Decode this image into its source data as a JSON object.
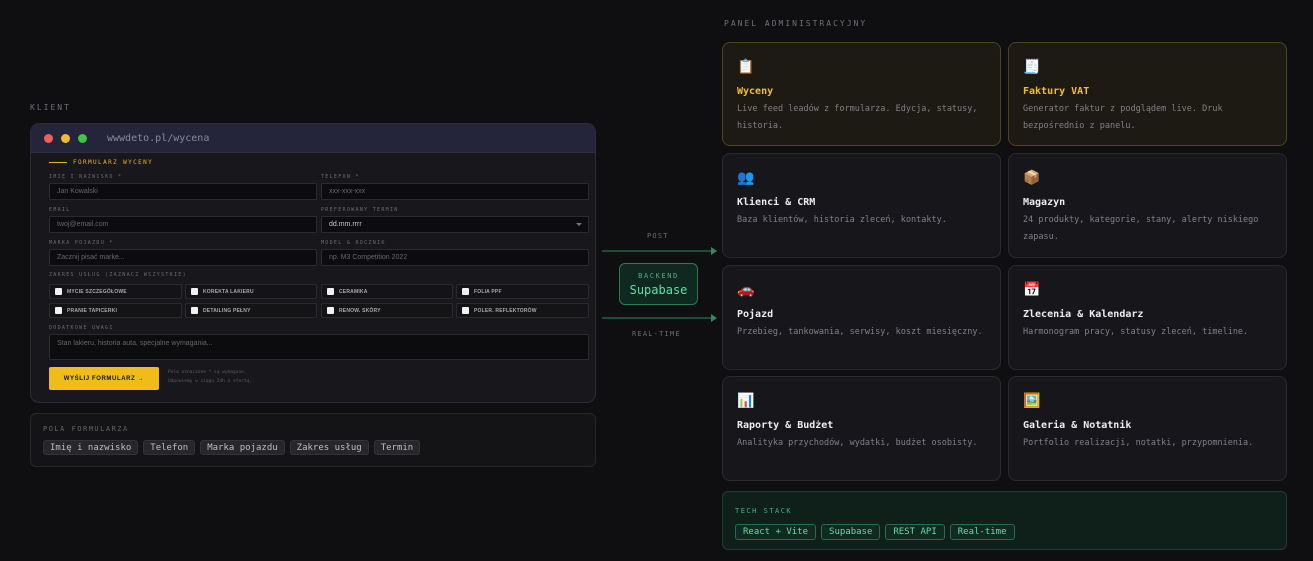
{
  "client": {
    "label": "KLIENT",
    "browser": {
      "url": "wwwdeto.pl/wycena",
      "form_title": "FORMULARZ WYCENY",
      "fields": {
        "name_label": "IMIĘ I NAZWISKO *",
        "name_placeholder": "Jan Kowalski",
        "phone_label": "TELEFON *",
        "phone_placeholder": "xxx-xxx-xxx",
        "email_label": "EMAIL",
        "email_placeholder": "twoj@email.com",
        "date_label": "PREFEROWANY TERMIN",
        "date_value": "dd.mm.rrrr",
        "brand_label": "MARKA POJAZDU *",
        "brand_placeholder": "Zacznij pisać marke...",
        "model_label": "MODEL & ROCZNIK",
        "model_placeholder": "np. M3 Competition 2022",
        "services_label": "ZAKRES USŁUG (ZAZNACZ WSZYSTKIE)",
        "services": [
          "MYCIE SZCZEGÓŁOWE",
          "KOREKTA LAKIERU",
          "CERAMIKA",
          "FOLIA PPF",
          "PRANIE TAPICERKI",
          "DETAILING PEŁNY",
          "RENOW. SKÓRY",
          "POLER. REFLEKTORÓW"
        ],
        "notes_label": "DODATKOWE UWAGI",
        "notes_placeholder": "Stan lakieru, historia auta, specjalne wymagania..."
      },
      "submit_label": "WYŚLIJ FORMULARZ →",
      "note_line1": "Pola oznaczone * są wymagane.",
      "note_line2": "Odpowiemy w ciągu 24h z ofertą."
    },
    "form_fields_box": {
      "label": "POLA FORMULARZA",
      "chips": [
        "Imię i nazwisko",
        "Telefon",
        "Marka pojazdu",
        "Zakres usług",
        "Termin"
      ]
    }
  },
  "flow": {
    "post_label": "POST",
    "realtime_label": "REAL-TIME",
    "backend_label": "BACKEND",
    "backend_name": "Supabase"
  },
  "admin": {
    "label": "PANEL ADMINISTRACYJNY",
    "cards": [
      {
        "icon": "📋",
        "icon_name": "clipboard-icon",
        "title": "Wyceny",
        "desc": "Live feed leadów z formularza. Edycja, statusy, historia.",
        "highlight": true
      },
      {
        "icon": "🧾",
        "icon_name": "receipt-icon",
        "title": "Faktury VAT",
        "desc": "Generator faktur z podglądem live. Druk bezpośrednio z panelu.",
        "highlight": true
      },
      {
        "icon": "👥",
        "icon_name": "users-icon",
        "title": "Klienci & CRM",
        "desc": "Baza klientów, historia zleceń, kontakty.",
        "highlight": false
      },
      {
        "icon": "📦",
        "icon_name": "package-icon",
        "title": "Magazyn",
        "desc": "24 produkty, kategorie, stany, alerty niskiego zapasu.",
        "highlight": false
      },
      {
        "icon": "🚗",
        "icon_name": "car-icon",
        "title": "Pojazd",
        "desc": "Przebieg, tankowania, serwisy, koszt miesięczny.",
        "highlight": false
      },
      {
        "icon": "📅",
        "icon_name": "calendar-icon",
        "title": "Zlecenia & Kalendarz",
        "desc": "Harmonogram pracy, statusy zleceń, timeline.",
        "highlight": false
      },
      {
        "icon": "📊",
        "icon_name": "bar-chart-icon",
        "title": "Raporty & Budżet",
        "desc": "Analityka przychodów, wydatki, budżet osobisty.",
        "highlight": false
      },
      {
        "icon": "🖼️",
        "icon_name": "picture-icon",
        "title": "Galeria & Notatnik",
        "desc": "Portfolio realizacji, notatki, przypomnienia.",
        "highlight": false
      }
    ],
    "tech_stack": {
      "label": "TECH STACK",
      "chips": [
        "React + Vite",
        "Supabase",
        "REST API",
        "Real-time"
      ]
    }
  },
  "colors": {
    "accent_yellow": "#efbd1a",
    "accent_green": "#5fe0a6",
    "background": "#0f0f12"
  }
}
